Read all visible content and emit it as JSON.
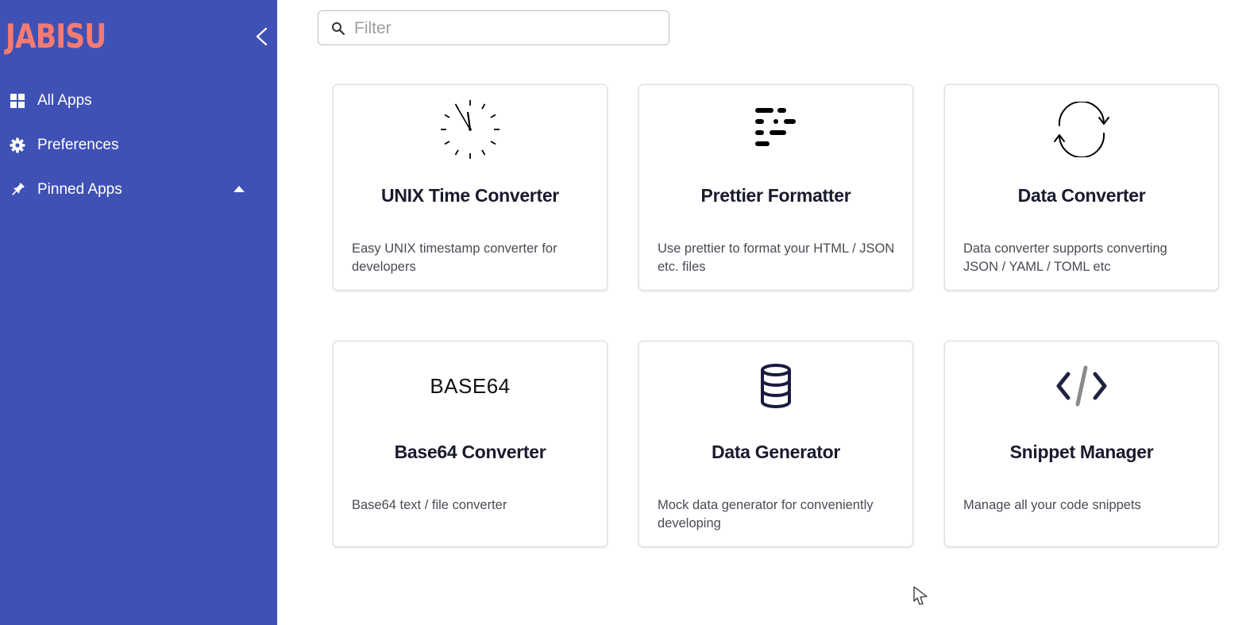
{
  "sidebar": {
    "logo": "JABISU",
    "items": [
      {
        "label": "All Apps",
        "icon": "grid-icon"
      },
      {
        "label": "Preferences",
        "icon": "gear-icon"
      },
      {
        "label": "Pinned Apps",
        "icon": "pin-icon",
        "expanded": true
      }
    ]
  },
  "filter": {
    "placeholder": "Filter",
    "value": ""
  },
  "apps": [
    {
      "title": "UNIX Time Converter",
      "description": "Easy UNIX timestamp converter for developers",
      "icon": "clock-icon"
    },
    {
      "title": "Prettier Formatter",
      "description": "Use prettier to format your HTML / JSON etc. files",
      "icon": "format-lines-icon"
    },
    {
      "title": "Data Converter",
      "description": "Data converter supports converting JSON / YAML / TOML etc",
      "icon": "sync-arrows-icon"
    },
    {
      "title": "Base64 Converter",
      "description": "Base64 text / file converter",
      "icon": "base64-text-icon",
      "icon_text": "BASE64"
    },
    {
      "title": "Data Generator",
      "description": "Mock data generator for conveniently developing",
      "icon": "database-icon"
    },
    {
      "title": "Snippet Manager",
      "description": "Manage all your code snippets",
      "icon": "code-icon"
    }
  ],
  "colors": {
    "sidebar_bg": "#3f51b5",
    "logo": "#f77b72",
    "title_text": "#1a1a2e",
    "desc_text": "#4a4a55"
  }
}
